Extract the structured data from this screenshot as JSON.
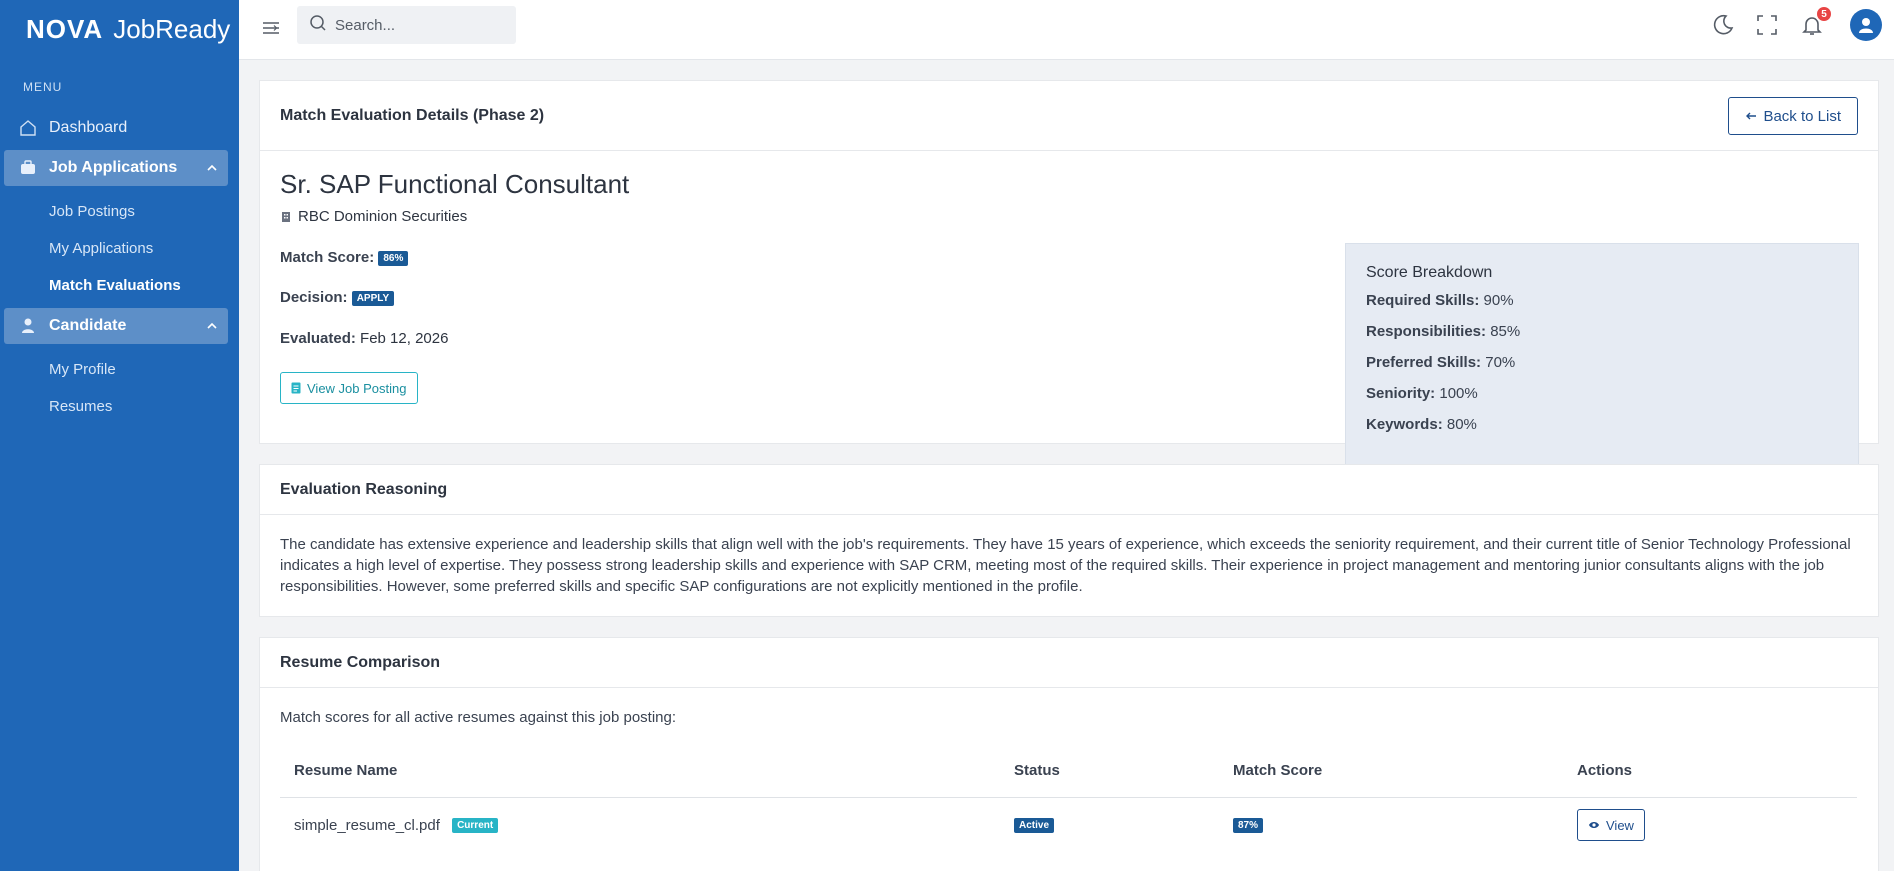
{
  "app": {
    "brand_bold": "NOVA",
    "brand_rest": "JobReady"
  },
  "sidebar": {
    "menu_label": "MENU",
    "dashboard": "Dashboard",
    "group_jobs": "Job Applications",
    "jobs_items": [
      "Job Postings",
      "My Applications",
      "Match Evaluations"
    ],
    "group_candidate": "Candidate",
    "candidate_items": [
      "My Profile",
      "Resumes"
    ]
  },
  "topbar": {
    "search_placeholder": "Search...",
    "notification_count": "5"
  },
  "details": {
    "header": "Match Evaluation Details (Phase 2)",
    "back_label": "Back to List",
    "job_title": "Sr. SAP Functional Consultant",
    "company": "RBC Dominion Securities",
    "match_score_label": "Match Score:",
    "match_score": "86%",
    "decision_label": "Decision:",
    "decision": "APPLY",
    "evaluated_label": "Evaluated:",
    "evaluated": "Feb 12, 2026",
    "view_posting_label": "View Job Posting"
  },
  "breakdown": {
    "title": "Score Breakdown",
    "rows": [
      {
        "label": "Required Skills:",
        "value": "90%"
      },
      {
        "label": "Responsibilities:",
        "value": "85%"
      },
      {
        "label": "Preferred Skills:",
        "value": "70%"
      },
      {
        "label": "Seniority:",
        "value": "100%"
      },
      {
        "label": "Keywords:",
        "value": "80%"
      }
    ]
  },
  "reasoning": {
    "header": "Evaluation Reasoning",
    "text": "The candidate has extensive experience and leadership skills that align well with the job's requirements. They have 15 years of experience, which exceeds the seniority requirement, and their current title of Senior Technology Professional indicates a high level of expertise. They possess strong leadership skills and experience with SAP CRM, meeting most of the required skills. Their experience in project management and mentoring junior consultants aligns with the job responsibilities. However, some preferred skills and specific SAP configurations are not explicitly mentioned in the profile."
  },
  "comparison": {
    "header": "Resume Comparison",
    "intro": "Match scores for all active resumes against this job posting:",
    "columns": [
      "Resume Name",
      "Status",
      "Match Score",
      "Actions"
    ],
    "rows": [
      {
        "name": "simple_resume_cl.pdf",
        "tag": "Current",
        "status": "Active",
        "score": "87%",
        "action": "View"
      }
    ]
  },
  "colors": {
    "sidebar": "#1f67b7",
    "primary_tag": "#1a5a96",
    "current_tag": "#28b4c6",
    "notification": "#e84545"
  }
}
